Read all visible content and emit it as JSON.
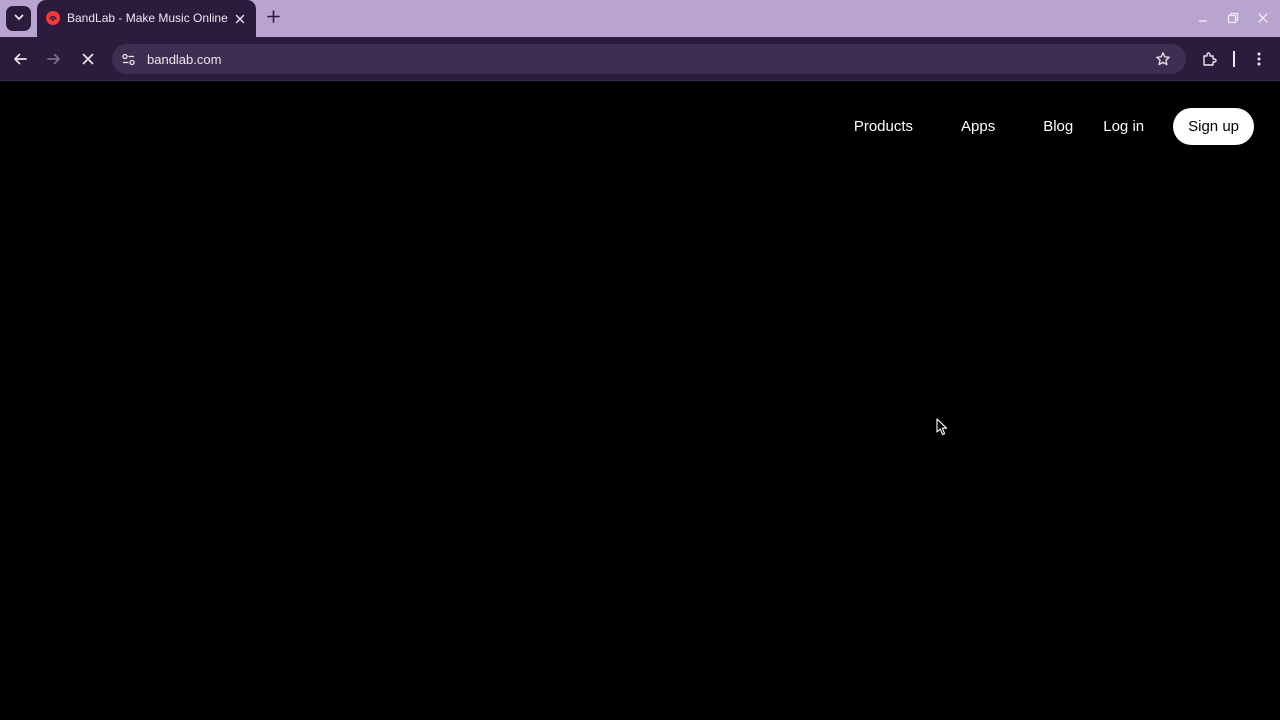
{
  "browser": {
    "tab": {
      "title": "BandLab - Make Music Online",
      "favicon": "bandlab-favicon-icon"
    },
    "omnibox": {
      "url": "bandlab.com"
    },
    "colors": {
      "tabstrip_bg": "#b9a3cf",
      "toolbar_bg": "#2c1b3d",
      "omnibox_bg": "#3f2e52"
    }
  },
  "site": {
    "nav": {
      "products": "Products",
      "apps": "Apps",
      "blog": "Blog",
      "login": "Log in",
      "signup": "Sign up"
    },
    "colors": {
      "page_bg": "#000000",
      "signup_bg": "#ffffff"
    }
  }
}
